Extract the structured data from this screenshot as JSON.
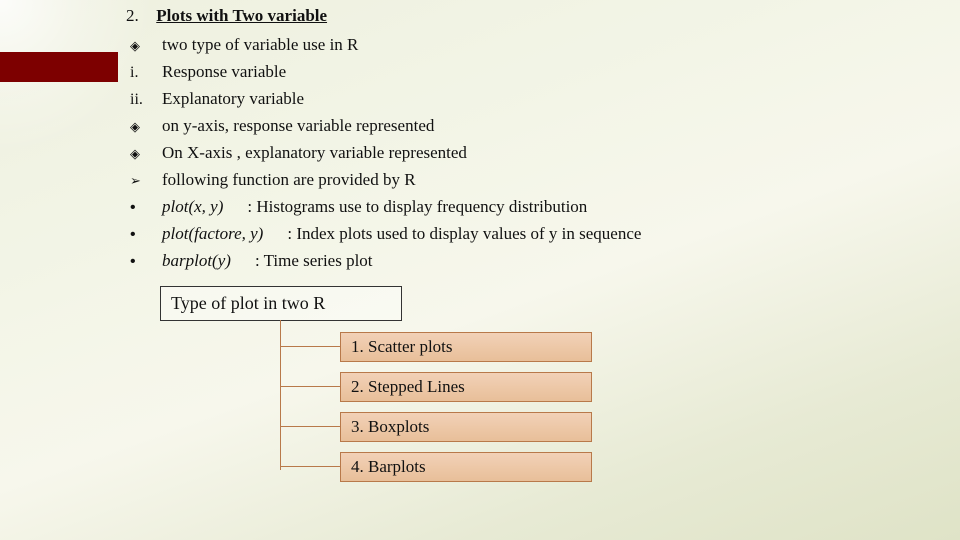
{
  "heading": {
    "num": "2.",
    "title": "Plots with Two variable"
  },
  "items": [
    {
      "bullet": "◈",
      "cls": "dia",
      "text": "two type of variable use in R"
    },
    {
      "bullet": "i.",
      "cls": "roman",
      "text": "Response variable"
    },
    {
      "bullet": "ii.",
      "cls": "roman",
      "text": "Explanatory variable"
    },
    {
      "bullet": "◈",
      "cls": "dia",
      "text": "on y-axis,  response variable represented"
    },
    {
      "bullet": "◈",
      "cls": "dia",
      "text": "On X-axis ,  explanatory variable represented"
    },
    {
      "bullet": "➢",
      "cls": "dia",
      "text": "following function are provided by R"
    }
  ],
  "funcs": [
    {
      "call": "plot(x, y)",
      "desc": ":  Histograms use to display frequency distribution"
    },
    {
      "call": "plot(factore, y)",
      "desc": ":  Index plots used to display values of y in sequence"
    },
    {
      "call": "barplot(y)",
      "desc": ":  Time series plot"
    }
  ],
  "box_title": "Type of plot in two R",
  "leaves": [
    "1. Scatter plots",
    "2. Stepped Lines",
    "3. Boxplots",
    "4. Barplots"
  ]
}
